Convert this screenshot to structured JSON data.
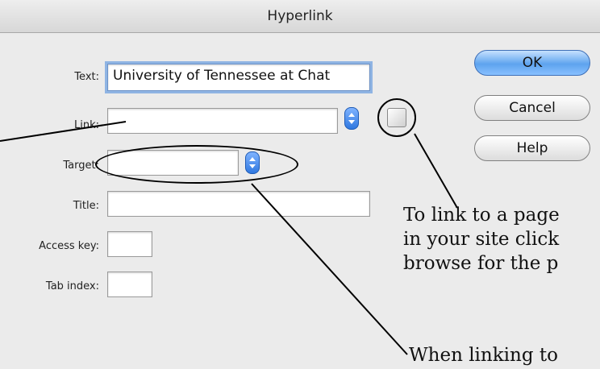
{
  "dialog": {
    "title": "Hyperlink",
    "labels": {
      "text": "Text:",
      "link": "Link:",
      "target": "Target:",
      "title": "Title:",
      "access_key": "Access key:",
      "tab_index": "Tab index:"
    },
    "fields": {
      "text_value": "University of Tennessee at Chat",
      "link_value": "",
      "target_value": "",
      "title_value": "",
      "access_key_value": "",
      "tab_index_value": ""
    },
    "buttons": {
      "ok": "OK",
      "cancel": "Cancel",
      "help": "Help"
    }
  },
  "annotations": {
    "browse_lines": [
      "To link to a page",
      "in your site click",
      "browse for the p"
    ],
    "target_line": "When linking to"
  },
  "icons": {
    "link_stepper": "stepper-icon",
    "target_stepper": "stepper-icon",
    "browse": "folder-icon"
  },
  "colors": {
    "accent_blue": "#2f78e0",
    "focus_ring": "#8fb4e3"
  }
}
